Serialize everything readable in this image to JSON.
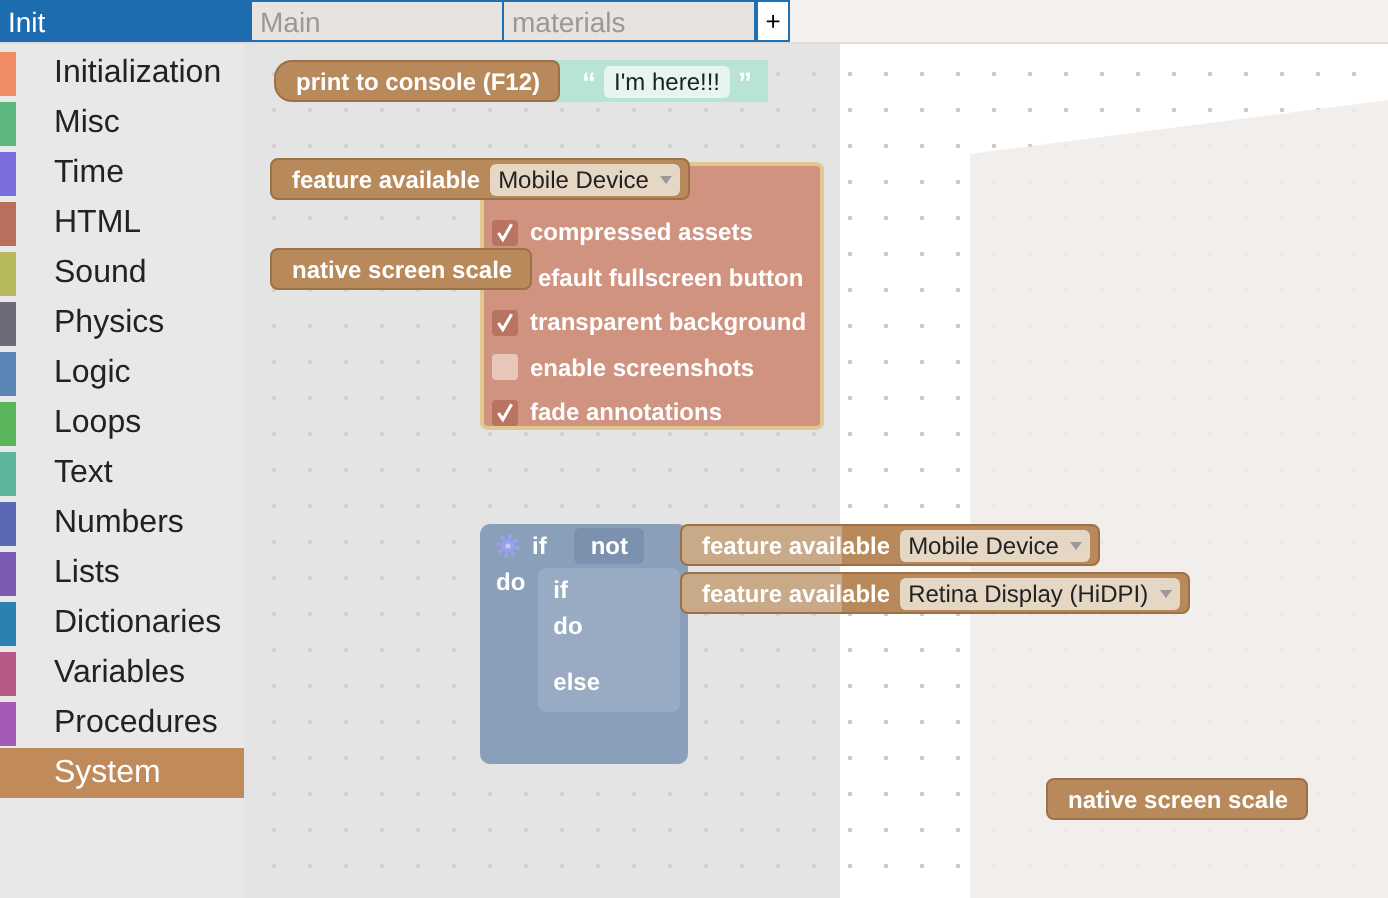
{
  "tabs": [
    {
      "label": "Init",
      "selected": true
    },
    {
      "label": "Main",
      "selected": false
    },
    {
      "label": "materials",
      "selected": false
    }
  ],
  "add_tab": "+",
  "categories": [
    {
      "label": "Initialization",
      "color": "#f08c64",
      "selected": false
    },
    {
      "label": "Misc",
      "color": "#5cb87e",
      "selected": false
    },
    {
      "label": "Time",
      "color": "#7b6fe0",
      "selected": false
    },
    {
      "label": "HTML",
      "color": "#b8705c",
      "selected": false
    },
    {
      "label": "Sound",
      "color": "#b8b85c",
      "selected": false
    },
    {
      "label": "Physics",
      "color": "#6b6b78",
      "selected": false
    },
    {
      "label": "Logic",
      "color": "#5b85b5",
      "selected": false
    },
    {
      "label": "Loops",
      "color": "#5bb55b",
      "selected": false
    },
    {
      "label": "Text",
      "color": "#5bb59a",
      "selected": false
    },
    {
      "label": "Numbers",
      "color": "#5b67b5",
      "selected": false
    },
    {
      "label": "Lists",
      "color": "#7c5bb5",
      "selected": false
    },
    {
      "label": "Dictionaries",
      "color": "#2a80b0",
      "selected": false
    },
    {
      "label": "Variables",
      "color": "#b55b85",
      "selected": false
    },
    {
      "label": "Procedures",
      "color": "#a55bb5",
      "selected": false
    },
    {
      "label": "System",
      "color": "#c08a5a",
      "selected": true
    }
  ],
  "flyout_blocks": [
    {
      "kind": "print",
      "label": "print to console (F12)",
      "open_quote": "“",
      "text_value": "I'm here!!!",
      "close_quote": "”"
    },
    {
      "kind": "feature",
      "label": "feature available",
      "option": "Mobile Device"
    },
    {
      "kind": "plain",
      "label": "native screen scale"
    }
  ],
  "workspace": {
    "settings_block": {
      "covered_item": "efault fullscreen button",
      "items": [
        {
          "label": "compressed assets",
          "checked": true
        },
        {
          "label": "transparent background",
          "checked": true
        },
        {
          "label": "enable screenshots",
          "checked": false
        },
        {
          "label": "fade annotations",
          "checked": true
        }
      ]
    },
    "logic_block": {
      "if_label": "if",
      "not_label": "not",
      "do_label": "do",
      "inner_if_label": "if",
      "inner_do_label": "do",
      "else_label": "else"
    },
    "blocks": [
      {
        "kind": "feature",
        "label": "feature available",
        "option": "Mobile Device"
      },
      {
        "kind": "feature",
        "label": "feature available",
        "option": "Retina Display (HiDPI)"
      },
      {
        "kind": "plain",
        "label": "native screen scale"
      }
    ]
  }
}
